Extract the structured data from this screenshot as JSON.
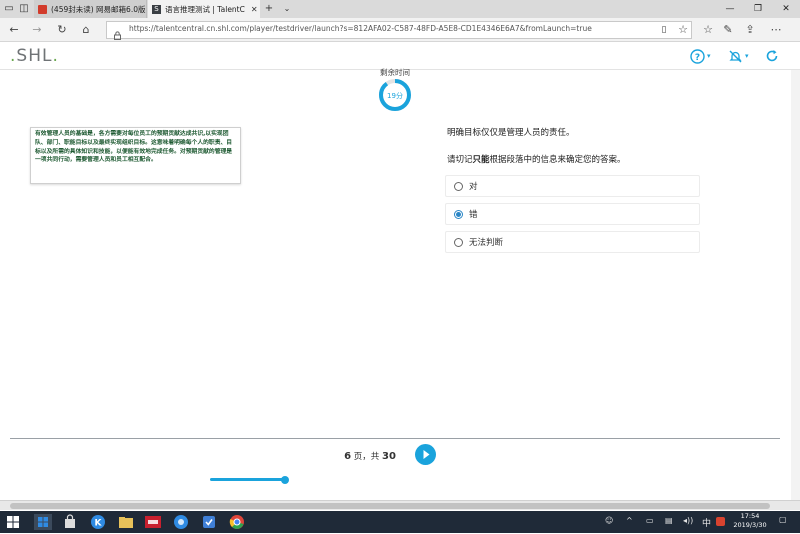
{
  "browser": {
    "tabs": [
      {
        "label": "(459封未读) 网易邮箱6.0版",
        "active": false
      },
      {
        "label": "语言推理测试 | TalentC",
        "active": true
      }
    ],
    "url": "https://talentcentral.cn.shl.com/player/testdriver/launch?s=812AFA02-C587-48FD-A5E8-CD1E4346E6A7&fromLaunch=true"
  },
  "app": {
    "logo": "SHL",
    "timer": {
      "label": "剩余时间",
      "value": "19分",
      "remaining_fraction": 0.9
    }
  },
  "passage": {
    "text": "有效管理人员的基础是，各方需要对每位员工的预期贡献达成共识,以实现团队、部门、职能目标以及最终实现组织目标。这意味着明确每个人的职责、目标以及所需的具体知识和技能，以便能有效地完成任务。对预期贡献的管理是一项共同行动，需要管理人员和员工相互配合。"
  },
  "question": {
    "statement": "明确目标仅仅是管理人员的责任。",
    "instruction_prefix": "请切记",
    "instruction_bold": "只能",
    "instruction_suffix": "根据段落中的信息来确定您的答案。",
    "options": [
      {
        "label": "对",
        "selected": false
      },
      {
        "label": "错",
        "selected": true
      },
      {
        "label": "无法判断",
        "selected": false
      }
    ]
  },
  "footer": {
    "current_page": "6",
    "page_mid": "页，共",
    "total_pages": "30",
    "progress_fraction": 0.2
  },
  "taskbar": {
    "ime": "中",
    "time": "17:54",
    "date": "2019/3/30"
  },
  "colors": {
    "accent": "#1aa3dc",
    "passage_text": "#1e5a32",
    "taskbar": "#1f2a38"
  }
}
